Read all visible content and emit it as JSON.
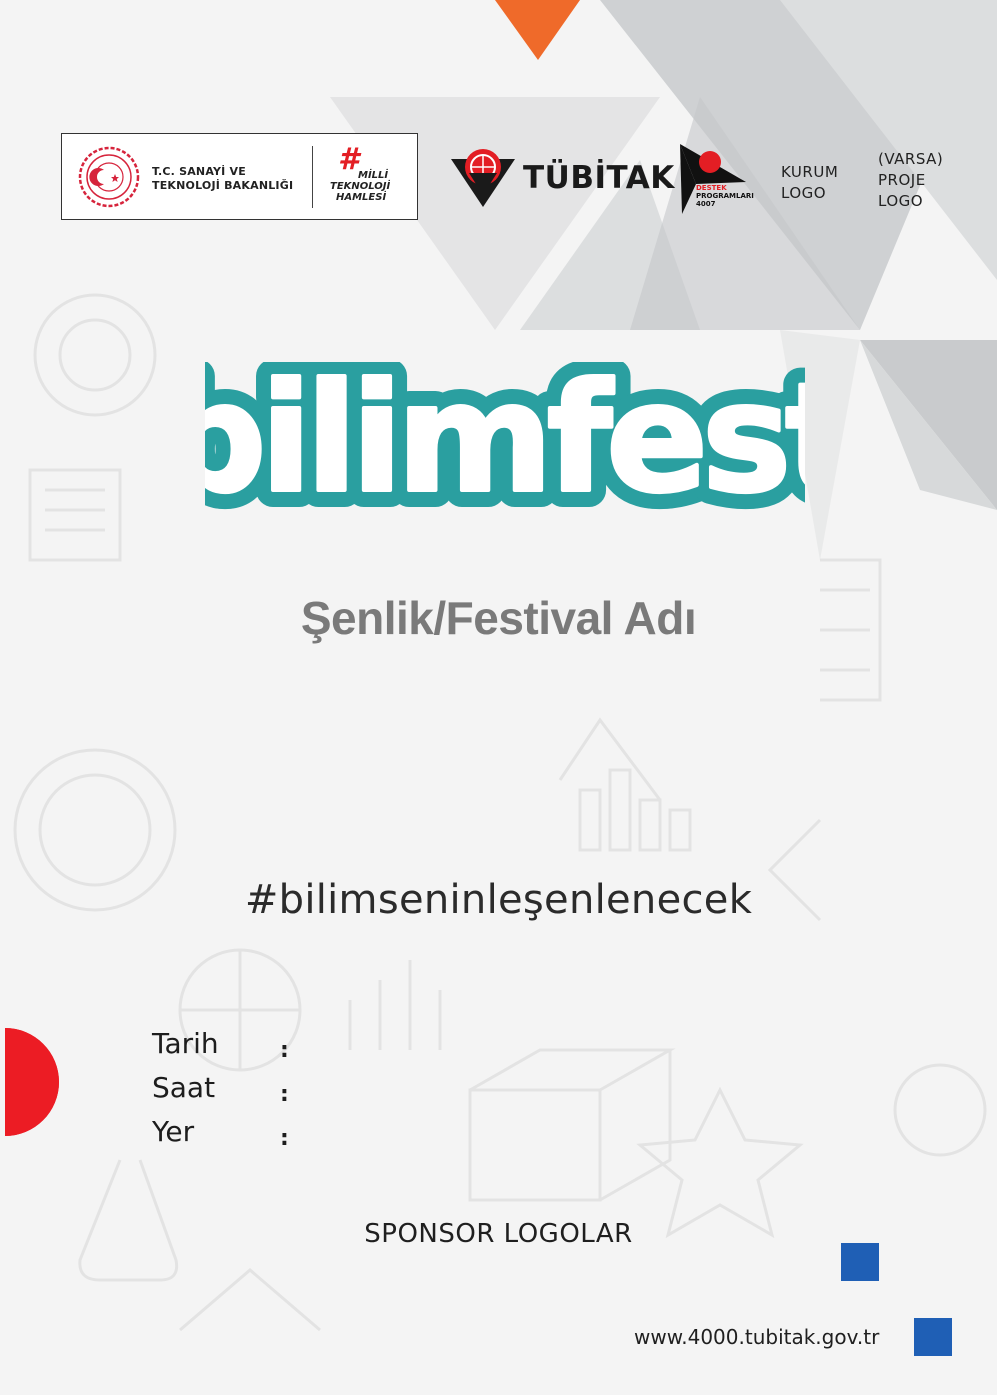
{
  "header": {
    "ministry": {
      "line1": "T.C. SANAYİ VE",
      "line2": "TEKNOLOJİ BAKANLIĞI"
    },
    "milli": {
      "hash": "#",
      "line1": "MİLLİ",
      "line2": "TEKNOLOJİ",
      "line3": "HAMLESİ"
    },
    "tubitak": "TÜBİTAK",
    "destek": {
      "line1": "DESTEK",
      "line2": "PROGRAMLARI",
      "line3": "4007"
    },
    "kurum_logo": {
      "line1": "KURUM",
      "line2": "LOGO"
    },
    "proje_logo": {
      "line1": "(VARSA)",
      "line2": "PROJE",
      "line3": "LOGO"
    }
  },
  "title": {
    "brand": "bilimfest",
    "festival_name": "Şenlik/Festival Adı"
  },
  "hashtag": "#bilimseninleşenlenecek",
  "info": {
    "date_label": "Tarih",
    "time_label": "Saat",
    "place_label": "Yer",
    "colon": ":"
  },
  "footer": {
    "sponsor": "SPONSOR LOGOLAR",
    "website": "www.4000.tubitak.gov.tr"
  },
  "colors": {
    "brand_teal": "#2a9fa0",
    "orange_accent": "#ef6a2a",
    "red_accent": "#ec1c24",
    "blue_accent": "#1f5fb5",
    "gray_triangle": "#c9cbcd"
  }
}
